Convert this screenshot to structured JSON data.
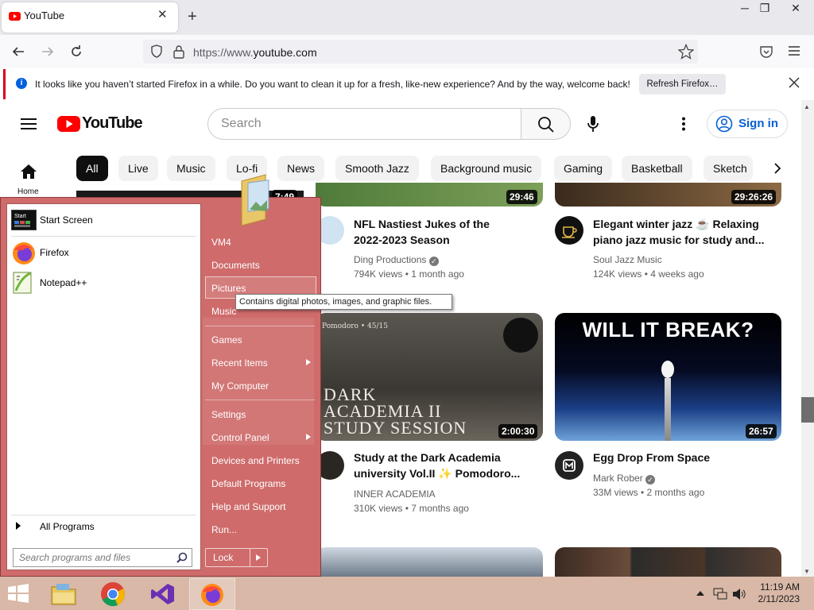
{
  "browser": {
    "tab_title": "YouTube",
    "url_scheme": "https://www.",
    "url_host": "youtube.com",
    "notification": "It looks like you haven’t started Firefox in a while. Do you want to clean it up for a fresh, like-new experience? And by the way, welcome back!",
    "refresh_button": "Refresh Firefox…"
  },
  "youtube": {
    "logo_text": "YouTube",
    "search_placeholder": "Search",
    "sign_in": "Sign in",
    "home_label": "Home",
    "chips": [
      "All",
      "Live",
      "Music",
      "Lo-fi",
      "News",
      "Smooth Jazz",
      "Background music",
      "Gaming",
      "Basketball",
      "Sketch"
    ],
    "videos": [
      {
        "title1": "NFL Nastiest Jukes of the",
        "title2": "2022-2023 Season",
        "channel": "Ding Productions",
        "meta": "794K views • 1 month ago",
        "duration": "29:46"
      },
      {
        "title1": "Elegant winter jazz ☕ Relaxing",
        "title2": "piano jazz music for study and...",
        "channel": "Soul Jazz Music",
        "meta": "124K views • 4 weeks ago",
        "duration": "29:26:26"
      },
      {
        "title1": "Study at the Dark Academia",
        "title2": "university Vol.II ✨ Pomodoro...",
        "channel": "INNER ACADEMIA",
        "meta": "310K views • 7 months ago",
        "duration": "2:00:30",
        "thumb_small": "Pomodoro • 45/15",
        "thumb_line1": "DARK",
        "thumb_line2": "ACADEMIA II",
        "thumb_line3": "STUDY SESSION"
      },
      {
        "title1": "Egg Drop From Space",
        "title2": "",
        "channel": "Mark Rober",
        "meta": "33M views • 2 months ago",
        "duration": "26:57",
        "thumb_text": "WILL IT BREAK?"
      }
    ],
    "partial_duration": "7:49"
  },
  "start_menu": {
    "pinned": [
      "Start Screen",
      "Firefox",
      "Notepad++"
    ],
    "all_programs": "All Programs",
    "search_placeholder": "Search programs and files",
    "right_items": [
      "VM4",
      "Documents",
      "Pictures",
      "Music",
      "Games",
      "Recent Items",
      "My Computer",
      "Settings",
      "Control Panel",
      "Devices and Printers",
      "Default Programs",
      "Help and Support",
      "Run..."
    ],
    "lock": "Lock",
    "tooltip": "Contains digital photos, images, and graphic files."
  },
  "taskbar": {
    "time": "11:19 AM",
    "date": "2/11/2023"
  },
  "colors": {
    "youtube_red": "#ff0000",
    "start_menu": "#cf6b6b",
    "taskbar": "#d9b8a7",
    "link_blue": "#065fd4"
  }
}
